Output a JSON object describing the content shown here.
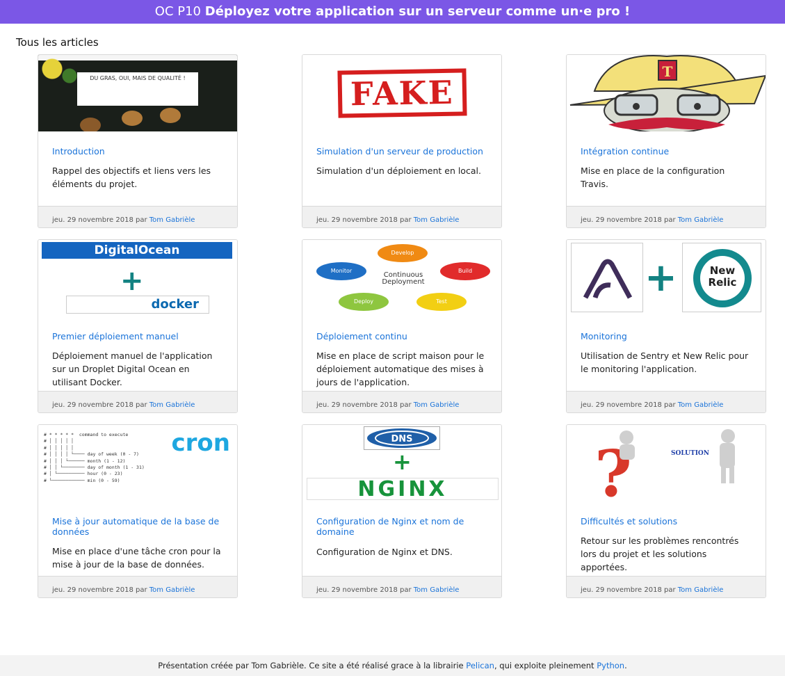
{
  "header": {
    "prefix": "OC P10",
    "title": "Déployez votre application sur un serveur comme un·e pro !"
  },
  "section_title": "Tous les articles",
  "cards": [
    {
      "title": "Introduction",
      "desc": "Rappel des objectifs et liens vers les éléments du projet.",
      "date": "jeu. 29 novembre 2018 par ",
      "author": "Tom Gabrièle",
      "thumb_text": "DU GRAS, OUI, MAIS DE QUALITÉ !"
    },
    {
      "title": "Simulation d'un serveur de production",
      "desc": "Simulation d'un déploiement en local.",
      "date": "jeu. 29 novembre 2018 par ",
      "author": "Tom Gabrièle",
      "thumb_text": "FAKE"
    },
    {
      "title": "Intégration continue",
      "desc": "Mise en place de la configuration Travis.",
      "date": "jeu. 29 novembre 2018 par ",
      "author": "Tom Gabrièle",
      "thumb_text": "T"
    },
    {
      "title": "Premier déploiement manuel",
      "desc": "Déploiement manuel de l'application sur un Droplet Digital Ocean en utilisant Docker.",
      "date": "jeu. 29 novembre 2018 par ",
      "author": "Tom Gabrièle",
      "thumb_text": "DigitalOcean",
      "thumb_text2": "docker"
    },
    {
      "title": "Déploiement continu",
      "desc": "Mise en place de script maison pour le déploiement automatique des mises à jours de l'application.",
      "date": "jeu. 29 novembre 2018 par ",
      "author": "Tom Gabrièle",
      "thumb_text": "Continuous Deployment",
      "cd_labels": [
        "Develop",
        "Build",
        "Test",
        "Deploy",
        "Monitor"
      ]
    },
    {
      "title": "Monitoring",
      "desc": "Utilisation de Sentry et New Relic pour le monitoring l'application.",
      "date": "jeu. 29 novembre 2018 par ",
      "author": "Tom Gabrièle",
      "thumb_text": "New Relic"
    },
    {
      "title": "Mise à jour automatique de la base de données",
      "desc": "Mise en place d'une tâche cron pour la mise à jour de la base de données.",
      "date": "jeu. 29 novembre 2018 par ",
      "author": "Tom Gabrièle",
      "thumb_text": "cron",
      "cron_lines": "# * * * * *  command to execute\n# │ │ │ │ │\n# │ │ │ │ │\n# │ │ │ │ └──── day of week (0 - 7)\n# │ │ │ └────── month (1 - 12)\n# │ │ └──────── day of month (1 - 31)\n# │ └────────── hour (0 - 23)\n# └──────────── min (0 - 59)"
    },
    {
      "title": "Configuration de Nginx et nom de domaine",
      "desc": "Configuration de Nginx et DNS.",
      "date": "jeu. 29 novembre 2018 par ",
      "author": "Tom Gabrièle",
      "thumb_text": "DNS",
      "thumb_text2": "NGINX"
    },
    {
      "title": "Difficultés et solutions",
      "desc": "Retour sur les problèmes rencontrés lors du projet et les solutions apportées.",
      "date": "jeu. 29 novembre 2018 par ",
      "author": "Tom Gabrièle",
      "thumb_text": "SOLUTION"
    }
  ],
  "footer": {
    "text1": "Présentation créée par Tom Gabrièle. Ce site a été réalisé grace à la librairie ",
    "link1": "Pelican",
    "text2": ", qui exploite pleinement ",
    "link2": "Python",
    "text3": "."
  }
}
